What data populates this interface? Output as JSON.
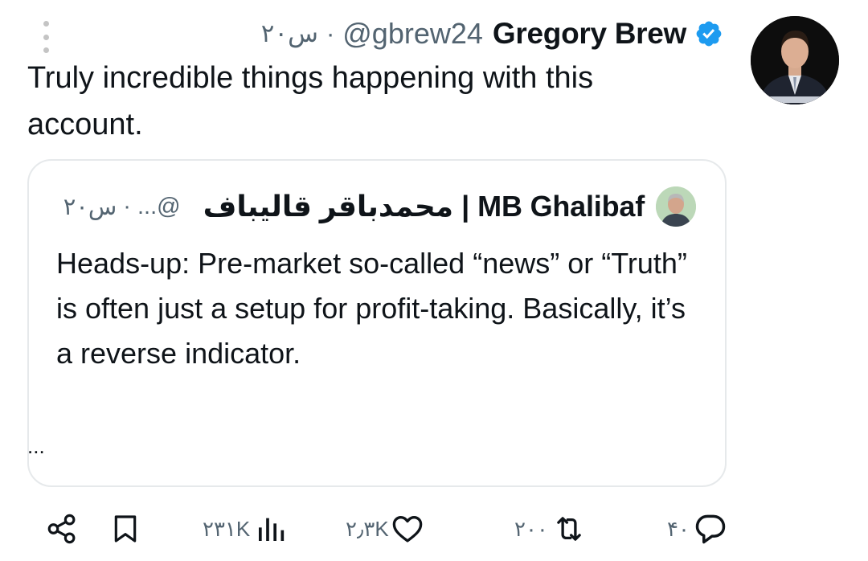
{
  "tweet": {
    "author_name": "Gregory Brew",
    "handle": "@gbrew24",
    "separator": "·",
    "time": "۲۰س",
    "text": "Truly incredible things happening with this account."
  },
  "quote": {
    "author_name": "محمدباقر قالیباف | MB Ghalibaf",
    "handle": "...@",
    "separator": "·",
    "time": "۲۰س",
    "text": "Heads-up: Pre-market so-called “news” or “Truth” is often just a setup for profit-taking. Basically, it’s a reverse indicator.",
    "more": "..."
  },
  "actions": {
    "replies": "۴۰",
    "reposts": "۲۰۰",
    "likes": "۲٫۳K",
    "views": "۲۳۱K"
  },
  "icons": {
    "more": "more-vertical-icon",
    "verified": "verified-badge-icon",
    "reply": "reply-icon",
    "repost": "repost-icon",
    "like": "heart-icon",
    "views": "views-icon",
    "bookmark": "bookmark-icon",
    "share": "share-icon"
  },
  "colors": {
    "verified": "#1d9bf0",
    "secondary_text": "#536471",
    "primary_text": "#0f1419",
    "card_border": "#e6e9eb"
  }
}
